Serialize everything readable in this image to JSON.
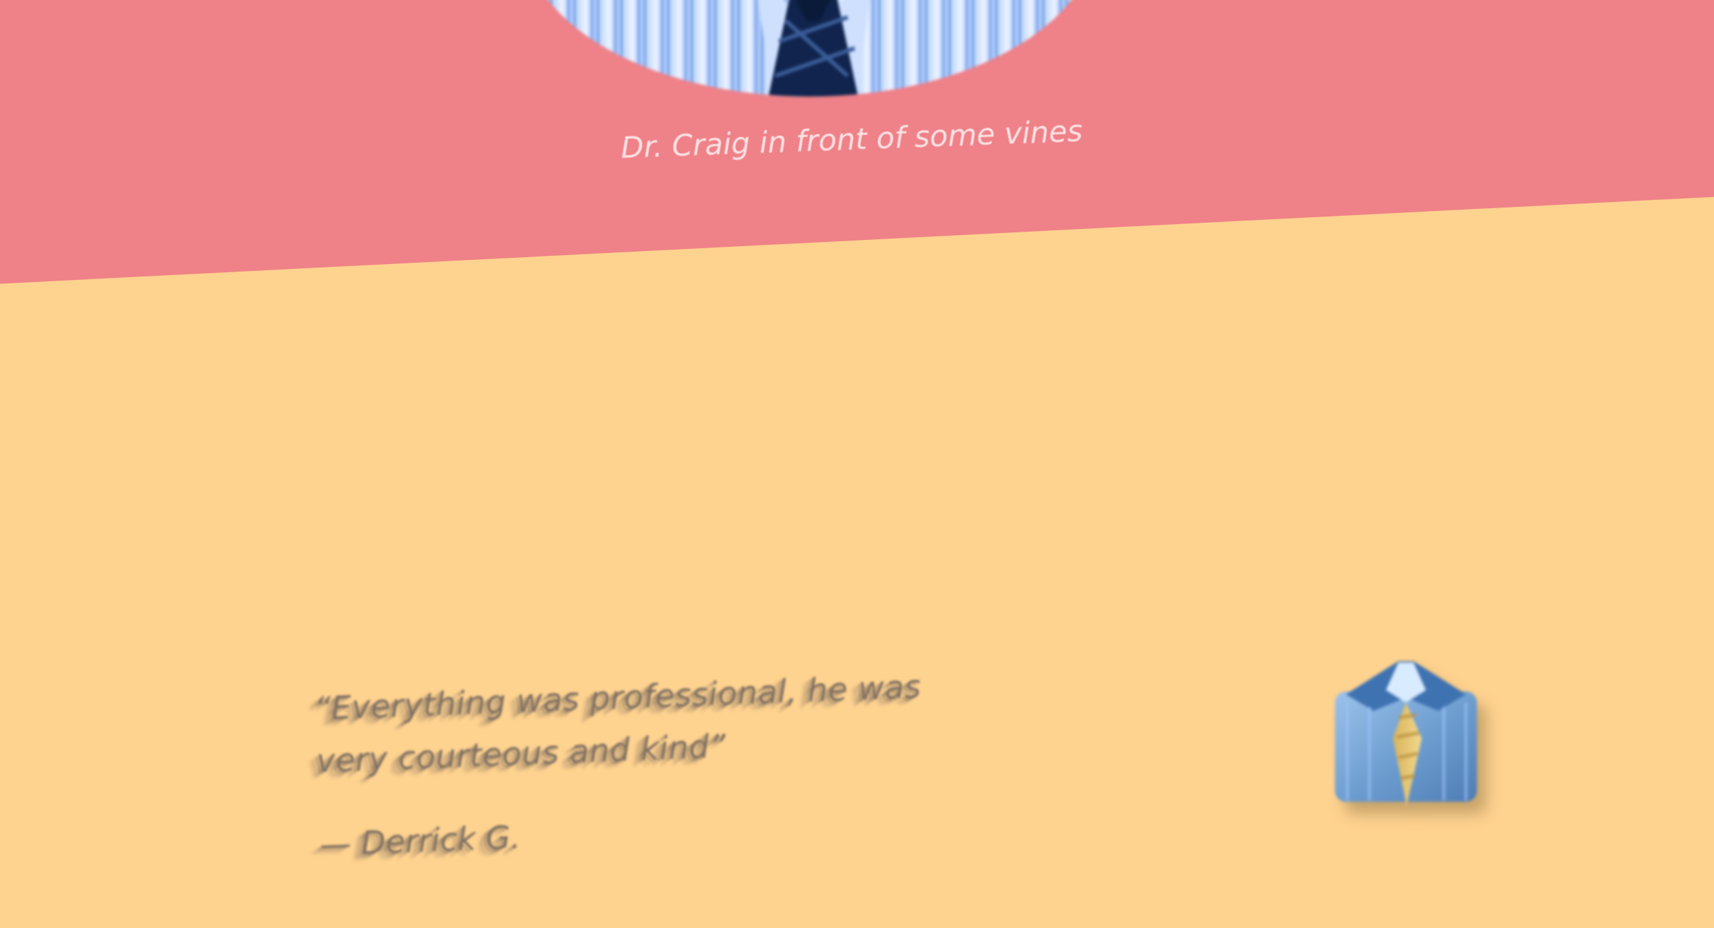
{
  "hero": {
    "photo_alt": "Dr. Craig portrait photo",
    "caption": "Dr. Craig in front of some vines"
  },
  "testimonial": {
    "quote": "“Everything was professional, he was very courteous and kind”",
    "author": "— Derrick G."
  },
  "icons": {
    "decor": "shirt-and-tie-icon"
  },
  "colors": {
    "top_band": "#ef8188",
    "background": "#fed28f",
    "text": "#7f7062"
  }
}
